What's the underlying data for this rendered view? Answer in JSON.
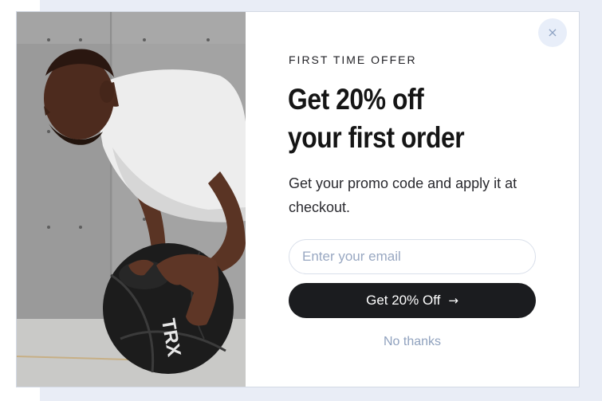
{
  "modal": {
    "close_label": "×",
    "eyebrow": "FIRST TIME OFFER",
    "headline_line1": "Get 20% off",
    "headline_line2": "your first order",
    "subtext": "Get your promo code and apply it at checkout.",
    "email_placeholder": "Enter your email",
    "email_value": "",
    "cta_label": "Get 20% Off",
    "cta_arrow": "→",
    "dismiss_label": "No thanks"
  },
  "image": {
    "ball_lettering": "TRX"
  },
  "colors": {
    "backdrop": "#e9edf6",
    "cta_background": "#1b1c1f",
    "muted_text": "#8fa1be",
    "close_button_bg": "#e8eef9"
  }
}
